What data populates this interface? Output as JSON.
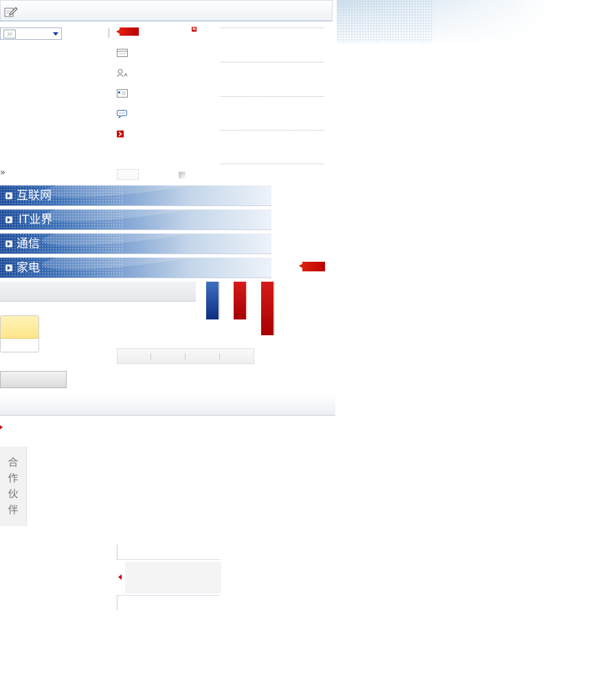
{
  "categories": [
    {
      "label": "互联网"
    },
    {
      "label": "IT业界"
    },
    {
      "label": "通信"
    },
    {
      "label": "家电"
    }
  ],
  "partners": {
    "label": "合作伙伴"
  },
  "date_select": {
    "icon_text": "30"
  },
  "badges": {
    "new": "N"
  },
  "more": {
    "glyph": "»"
  },
  "icons": [
    "edit-icon",
    "calendar-icon",
    "user-icon",
    "card-icon",
    "chat-icon",
    "arrow-right-icon"
  ],
  "colors": {
    "accent_red": "#c00000",
    "nav_blue": "#2a5aa8"
  }
}
